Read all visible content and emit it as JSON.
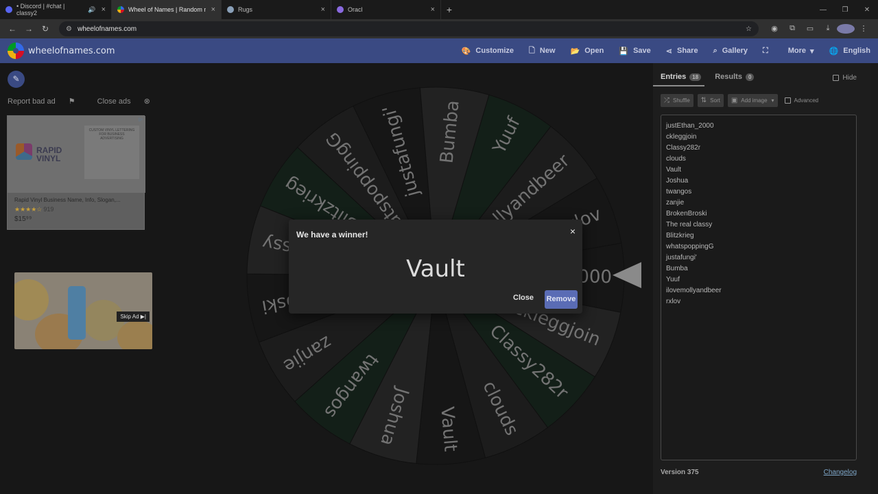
{
  "browser": {
    "tabs": [
      {
        "title": "• Discord | #chat | classy2",
        "favicon_color": "#5865f2",
        "audio": "🔊",
        "active": false
      },
      {
        "title": "Wheel of Names | Random nam",
        "favicon_color": "#e8a040",
        "active": true
      },
      {
        "title": "Rugs",
        "favicon_color": "#8aa0b8",
        "active": false
      },
      {
        "title": "Oracl",
        "favicon_color": "#8a6ae0",
        "active": false
      }
    ],
    "new_tab": "+",
    "url": "wheelofnames.com"
  },
  "app": {
    "brand": "wheelofnames.com",
    "menu": [
      {
        "icon": "palette-icon",
        "glyph": "🎨",
        "label": "Customize"
      },
      {
        "icon": "new-file-icon",
        "glyph": "🗋",
        "label": "New"
      },
      {
        "icon": "folder-icon",
        "glyph": "📂",
        "label": "Open"
      },
      {
        "icon": "save-icon",
        "glyph": "💾",
        "label": "Save"
      },
      {
        "icon": "share-icon",
        "glyph": "⋖",
        "label": "Share"
      },
      {
        "icon": "search-icon",
        "glyph": "⌕",
        "label": "Gallery"
      },
      {
        "icon": "fullscreen-icon",
        "glyph": "⛶",
        "label": ""
      },
      {
        "icon": "chevron-down-icon",
        "glyph": "▾",
        "label": "More"
      },
      {
        "icon": "globe-icon",
        "glyph": "🌐",
        "label": "English"
      }
    ]
  },
  "ads": {
    "report_bad_ad": "Report bad ad",
    "close_ads": "Close ads",
    "ad1": {
      "brand": "RAPID VINYL",
      "headline": "CUSTOM VINYL LETTERING FOR BUSINESS ADVERTISING",
      "title": "Rapid Vinyl Business Name, Info, Slogan,...",
      "rating": "★★★★☆",
      "reviews": "919",
      "price": "$15⁹⁹"
    },
    "ad2": {
      "skip": "Skip Ad ▶|"
    }
  },
  "wheel": {
    "segment_colors": [
      "#1e1e1e",
      "#2e2e2e",
      "#1a2a20",
      "#262626"
    ],
    "labels": [
      "justEthan_2000",
      "ckleggjoin",
      "Classy282r",
      "clouds",
      "Vault",
      "Joshua",
      "twangos",
      "zanjie",
      "BrokenBroski",
      "The real classy",
      "Blitzkrieg",
      "whatspoppingG",
      "justafungi'",
      "Bumba",
      "Yuuf",
      "ilovemollyandbeer",
      "rxlov"
    ]
  },
  "modal": {
    "title": "We have a winner!",
    "close_x": "×",
    "winner": "Vault",
    "close": "Close",
    "remove": "Remove"
  },
  "panel": {
    "tab_entries": "Entries",
    "entries_count": "18",
    "tab_results": "Results",
    "results_count": "0",
    "hide": "Hide",
    "shuffle": "Shuffle",
    "sort": "Sort",
    "add_image": "Add image",
    "advanced": "Advanced",
    "entries": [
      "justEthan_2000",
      "ckleggjoin",
      "Classy282r",
      "clouds",
      "Vault",
      "Joshua",
      "twangos",
      "zanjie",
      "BrokenBroski",
      "The real classy",
      "Blitzkrieg",
      "whatspoppingG",
      "justafungi'",
      "Bumba",
      "Yuuf",
      "ilovemollyandbeer",
      "rxlov"
    ],
    "version": "Version 375",
    "changelog": "Changelog"
  }
}
